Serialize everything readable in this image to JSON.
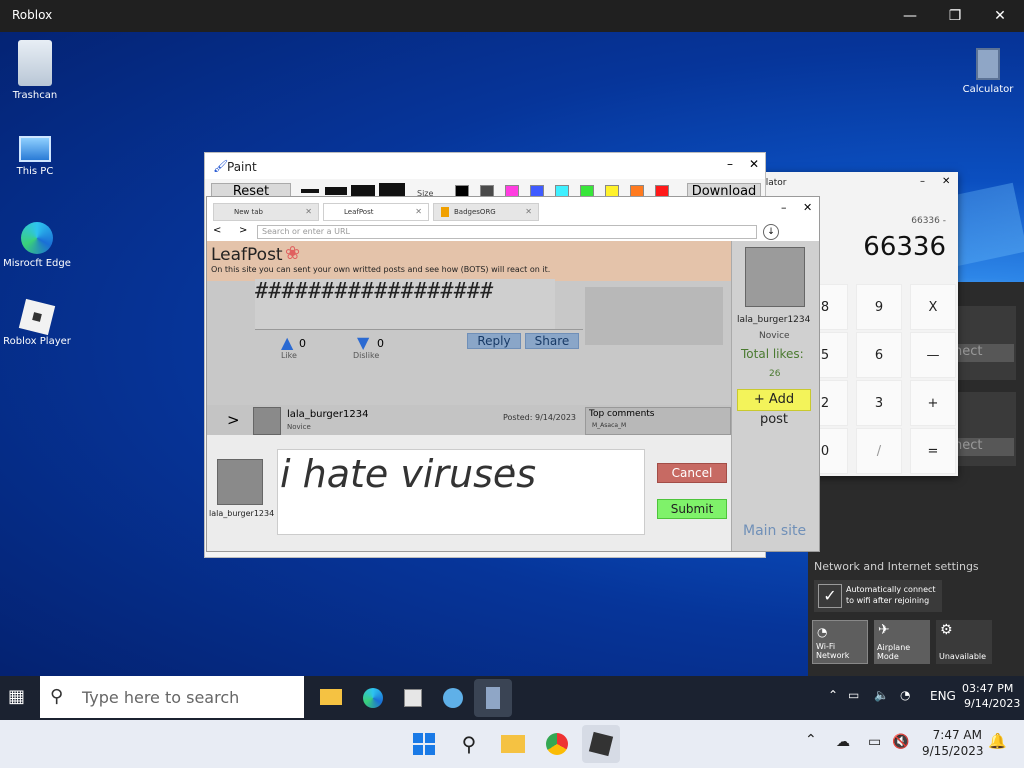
{
  "app_title": "Roblox",
  "desktop": {
    "icons": [
      {
        "label": "Trashcan",
        "icon": "trashcan-icon"
      },
      {
        "label": "This PC",
        "icon": "computer-icon"
      },
      {
        "label": "Misrocft Edge",
        "icon": "edge-icon"
      },
      {
        "label": "Roblox Player",
        "icon": "roblox-icon"
      },
      {
        "label": "Calculator",
        "icon": "calculator-icon"
      }
    ]
  },
  "calculator": {
    "title": "ulator",
    "expression": "66336 -",
    "display": "66336",
    "keys": [
      "8",
      "9",
      "X",
      "5",
      "6",
      "—",
      "2",
      "3",
      "+",
      "0",
      "/",
      "="
    ]
  },
  "net_panel": {
    "connect_1": "nect",
    "connect_2": "nect",
    "settings_label": "Network and Internet settings",
    "auto_connect": "Automatically connect to wifi after rejoining",
    "tiles": [
      {
        "label": "Wi-Fi Network",
        "icon": "wifi-icon"
      },
      {
        "label": "Airplane Mode",
        "icon": "airplane-icon"
      },
      {
        "label": "Unavailable",
        "icon": "gear-icon"
      }
    ]
  },
  "paint": {
    "title": "Paint",
    "button_left": "Reset",
    "button_right": "Download",
    "size_label": "Size",
    "colors": [
      "#000000",
      "#4a4a4a",
      "#ff3de0",
      "#3f5bff",
      "#3ff0ff",
      "#38e63a",
      "#fff22b",
      "#ff7a1f",
      "#ff1a1a"
    ]
  },
  "browser": {
    "tabs": [
      {
        "label": "New tab"
      },
      {
        "label": "LeafPost"
      },
      {
        "label": "BadgesORG"
      }
    ],
    "url_placeholder": "Search or enter a URL",
    "nav_back": "<",
    "nav_forward": ">"
  },
  "leafpost": {
    "logo": "LeafPost",
    "tagline": "On this site you can sent your own writted posts and see how (BOTS) will react on it.",
    "post_text": "##################",
    "likes": "0",
    "like_label": "Like",
    "dislikes": "0",
    "dislike_label": "Dislike",
    "reply": "Reply",
    "share": "Share",
    "next_arrow": ">",
    "next_post_user": "lala_burger1234",
    "next_post_rank": "Novice",
    "next_post_date": "Posted: 9/14/2023",
    "top_comments": "Top comments",
    "top_comment_user": "M_Asaca_M",
    "composer_user": "lala_burger1234",
    "composer_text": "i hate viruses",
    "cancel": "Cancel",
    "submit": "Submit",
    "profile_name": "lala_burger1234",
    "profile_rank": "Novice",
    "total_likes_label": "Total likes:",
    "total_likes": "26",
    "add_post": "+ Add post",
    "main_site": "Main site",
    "accent": "#f3f35a"
  },
  "taskbar_inner": {
    "search_placeholder": "Type here to search",
    "battery_icon": "battery-icon",
    "volume_icon": "volume-icon",
    "network_icon": "wifi-icon",
    "language": "ENG",
    "time": "03:47 PM",
    "date": "9/14/2023"
  },
  "taskbar_host": {
    "time": "7:47 AM",
    "date": "9/15/2023"
  }
}
